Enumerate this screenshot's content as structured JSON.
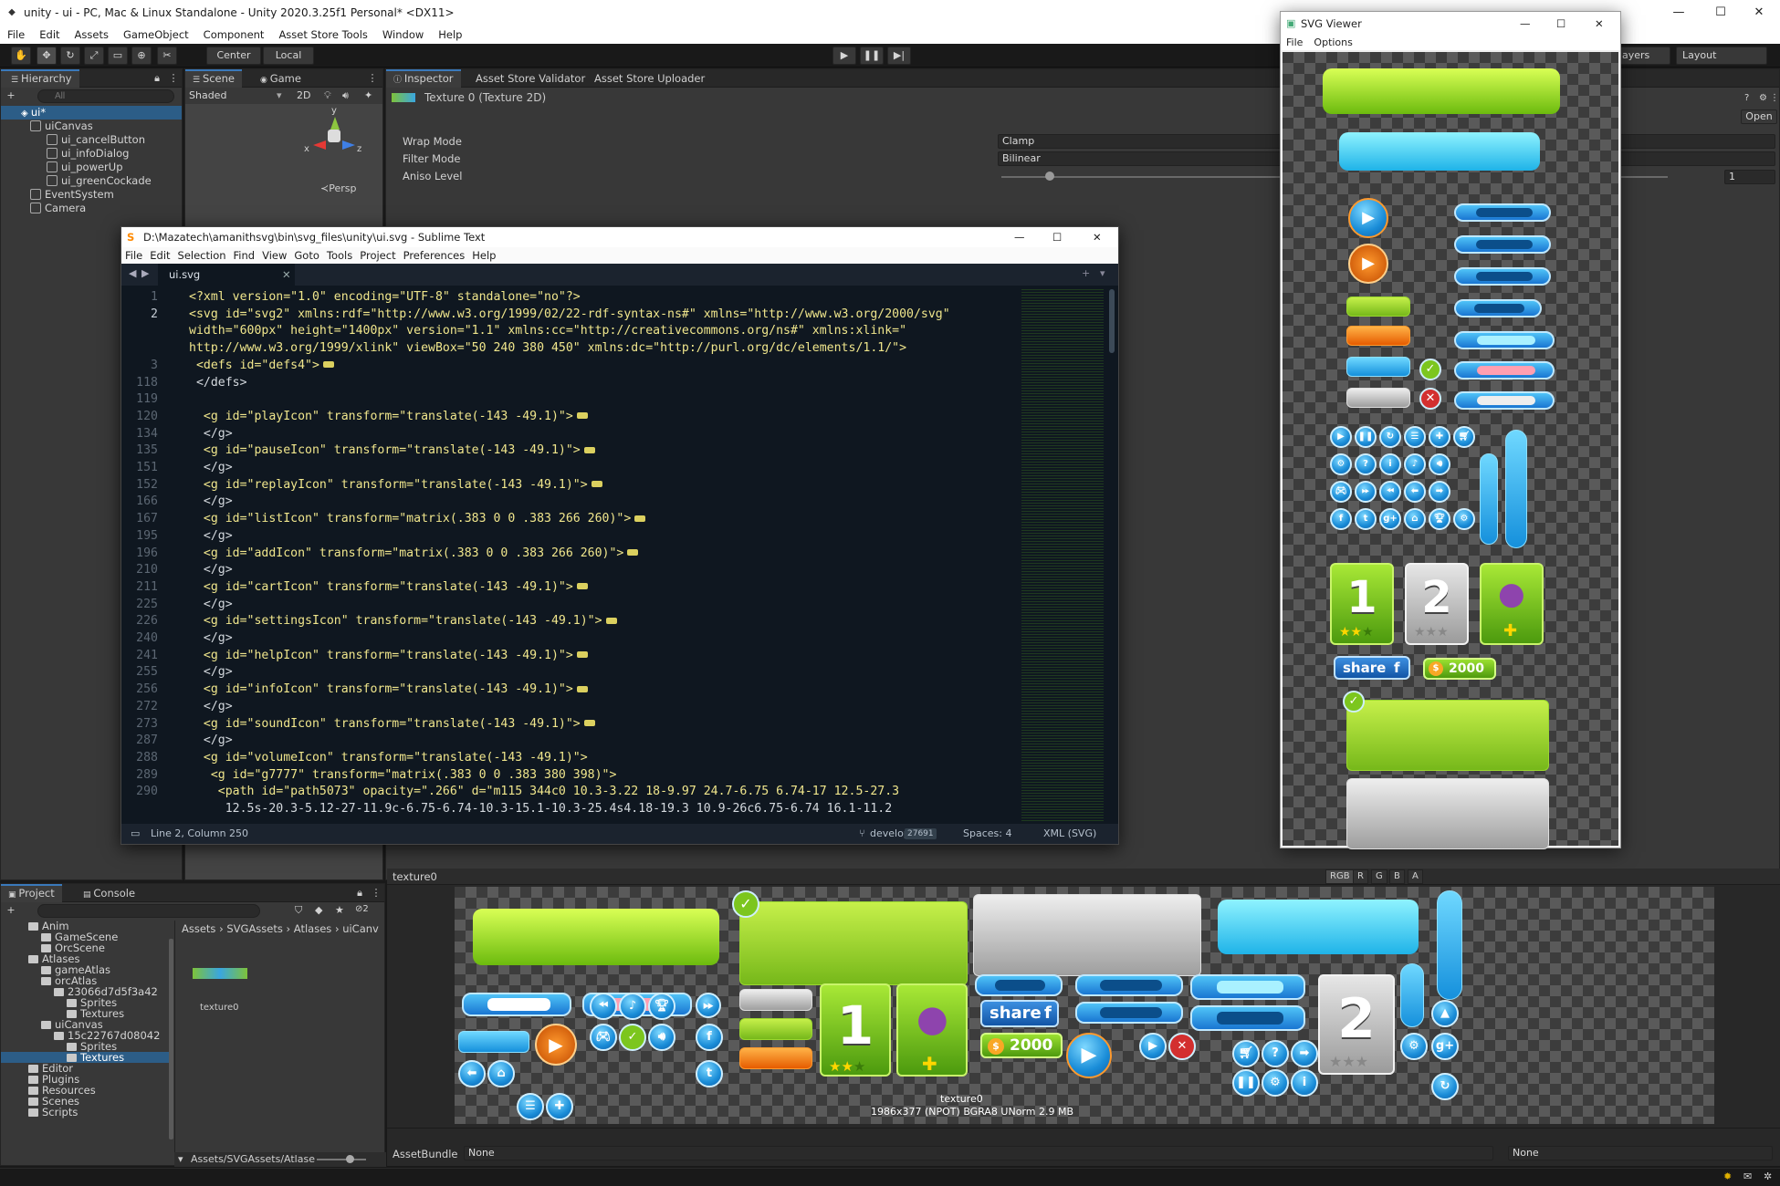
{
  "title_bar": {
    "title": "unity - ui - PC, Mac & Linux Standalone - Unity 2020.3.25f1 Personal* <DX11>",
    "minimize": "—",
    "maximize": "☐",
    "close": "✕"
  },
  "menu": [
    "File",
    "Edit",
    "Assets",
    "GameObject",
    "Component",
    "Asset Store Tools",
    "Window",
    "Help"
  ],
  "toolbar": {
    "center": "Center",
    "local": "Local",
    "play": "▶",
    "pause": "❚❚",
    "step": "▶|",
    "layers": "ayers",
    "layout": "Layout"
  },
  "hierarchy": {
    "tab": "Hierarchy",
    "search_placeholder": "All",
    "scene": "ui*",
    "items": [
      {
        "label": "uiCanvas",
        "indent": 1
      },
      {
        "label": "ui_cancelButton",
        "indent": 2
      },
      {
        "label": "ui_infoDialog",
        "indent": 2
      },
      {
        "label": "ui_powerUp",
        "indent": 2
      },
      {
        "label": "ui_greenCockade",
        "indent": 2
      },
      {
        "label": "EventSystem",
        "indent": 1
      },
      {
        "label": "Camera",
        "indent": 1
      }
    ]
  },
  "scene": {
    "tab_scene": "Scene",
    "tab_game": "Game",
    "shading": "Shaded",
    "mode2d": "2D",
    "persp": "≺Persp",
    "axis_x": "x",
    "axis_y": "y",
    "axis_z": "z"
  },
  "inspector": {
    "tabs": [
      "Inspector",
      "Asset Store Validator",
      "Asset Store Uploader"
    ],
    "asset_title": "Texture 0 (Texture 2D)",
    "open": "Open",
    "fields": [
      {
        "label": "Wrap Mode",
        "value": "Clamp"
      },
      {
        "label": "Filter Mode",
        "value": "Bilinear"
      },
      {
        "label": "Aniso Level",
        "value": "1"
      }
    ]
  },
  "sublime": {
    "title": "D:\\Mazatech\\amanithsvg\\bin\\svg_files\\unity\\ui.svg - Sublime Text",
    "menu": [
      "File",
      "Edit",
      "Selection",
      "Find",
      "View",
      "Goto",
      "Tools",
      "Project",
      "Preferences",
      "Help"
    ],
    "tab": "ui.svg",
    "line_numbers": [
      "1",
      "2",
      "",
      "",
      "3",
      "118",
      "119",
      "120",
      "134",
      "135",
      "151",
      "152",
      "166",
      "167",
      "195",
      "196",
      "210",
      "211",
      "225",
      "226",
      "240",
      "241",
      "255",
      "256",
      "272",
      "273",
      "287",
      "288",
      "289",
      "290",
      ""
    ],
    "lines": [
      "<?xml version=\"1.0\" encoding=\"UTF-8\" standalone=\"no\"?>",
      "<svg id=\"svg2\" xmlns:rdf=\"http://www.w3.org/1999/02/22-rdf-syntax-ns#\" xmlns=\"http://www.w3.org/2000/svg\"",
      "width=\"600px\" height=\"1400px\" version=\"1.1\" xmlns:cc=\"http://creativecommons.org/ns#\" xmlns:xlink=\"",
      "http://www.w3.org/1999/xlink\" viewBox=\"50 240 380 450\" xmlns:dc=\"http://purl.org/dc/elements/1.1/\">",
      " <defs id=\"defs4\">",
      " </defs>",
      "",
      "  <g id=\"playIcon\" transform=\"translate(-143 -49.1)\">",
      "  </g>",
      "  <g id=\"pauseIcon\" transform=\"translate(-143 -49.1)\">",
      "  </g>",
      "  <g id=\"replayIcon\" transform=\"translate(-143 -49.1)\">",
      "  </g>",
      "  <g id=\"listIcon\" transform=\"matrix(.383 0 0 .383 266 260)\">",
      "  </g>",
      "  <g id=\"addIcon\" transform=\"matrix(.383 0 0 .383 266 260)\">",
      "  </g>",
      "  <g id=\"cartIcon\" transform=\"translate(-143 -49.1)\">",
      "  </g>",
      "  <g id=\"settingsIcon\" transform=\"translate(-143 -49.1)\">",
      "  </g>",
      "  <g id=\"helpIcon\" transform=\"translate(-143 -49.1)\">",
      "  </g>",
      "  <g id=\"infoIcon\" transform=\"translate(-143 -49.1)\">",
      "  </g>",
      "  <g id=\"soundIcon\" transform=\"translate(-143 -49.1)\">",
      "  </g>",
      "  <g id=\"volumeIcon\" transform=\"translate(-143 -49.1)\">",
      "   <g id=\"g7777\" transform=\"matrix(.383 0 0 .383 380 398)\">",
      "    <path id=\"path5073\" opacity=\".266\" d=\"m115 344c0 10.3-3.22 18-9.97 24.7-6.75 6.74-17 12.5-27.3",
      "     12.5s-20.3-5.12-27-11.9c-6.75-6.74-10.3-15.1-10.3-25.4s4.18-19.3 10.9-26c6.75-6.74 16.1-11.2"
    ],
    "status_left": "Line 2, Column 250",
    "branch": "develop",
    "branch_count": "27691",
    "spaces": "Spaces: 4",
    "syntax": "XML (SVG)"
  },
  "svg_viewer": {
    "title": "SVG Viewer",
    "menu": [
      "File",
      "Options"
    ],
    "digit1": "1",
    "digit2": "2",
    "share": "share",
    "coin": "2000"
  },
  "project": {
    "tab_project": "Project",
    "tab_console": "Console",
    "breadcrumb": [
      "Assets",
      "SVGAssets",
      "Atlases",
      "uiCanv"
    ],
    "tree": [
      {
        "label": "Anim",
        "indent": 1
      },
      {
        "label": "GameScene",
        "indent": 2
      },
      {
        "label": "OrcScene",
        "indent": 2
      },
      {
        "label": "Atlases",
        "indent": 1
      },
      {
        "label": "gameAtlas",
        "indent": 2
      },
      {
        "label": "orcAtlas",
        "indent": 2
      },
      {
        "label": "23066d7d5f3a42",
        "indent": 3
      },
      {
        "label": "Sprites",
        "indent": 4
      },
      {
        "label": "Textures",
        "indent": 4
      },
      {
        "label": "uiCanvas",
        "indent": 2
      },
      {
        "label": "15c22767d08042",
        "indent": 3
      },
      {
        "label": "Sprites",
        "indent": 4
      },
      {
        "label": "Textures",
        "indent": 4
      },
      {
        "label": "Editor",
        "indent": 1
      },
      {
        "label": "Plugins",
        "indent": 1
      },
      {
        "label": "Resources",
        "indent": 1
      },
      {
        "label": "Scenes",
        "indent": 1
      },
      {
        "label": "Scripts",
        "indent": 1
      }
    ],
    "asset_name": "texture0",
    "footer_path": "Assets/SVGAssets/Atlase"
  },
  "texture_preview": {
    "title": "texture0",
    "channels": [
      "RGB",
      "R",
      "G",
      "B",
      "A"
    ],
    "name": "texture0",
    "info": "1986x377 (NPOT)  BGRA8 UNorm   2.9 MB",
    "digit1": "1",
    "digit2": "2",
    "share": "share",
    "coin": "2000"
  },
  "assetbundle": {
    "label": "AssetBundle",
    "value": "None",
    "variant": "None"
  }
}
